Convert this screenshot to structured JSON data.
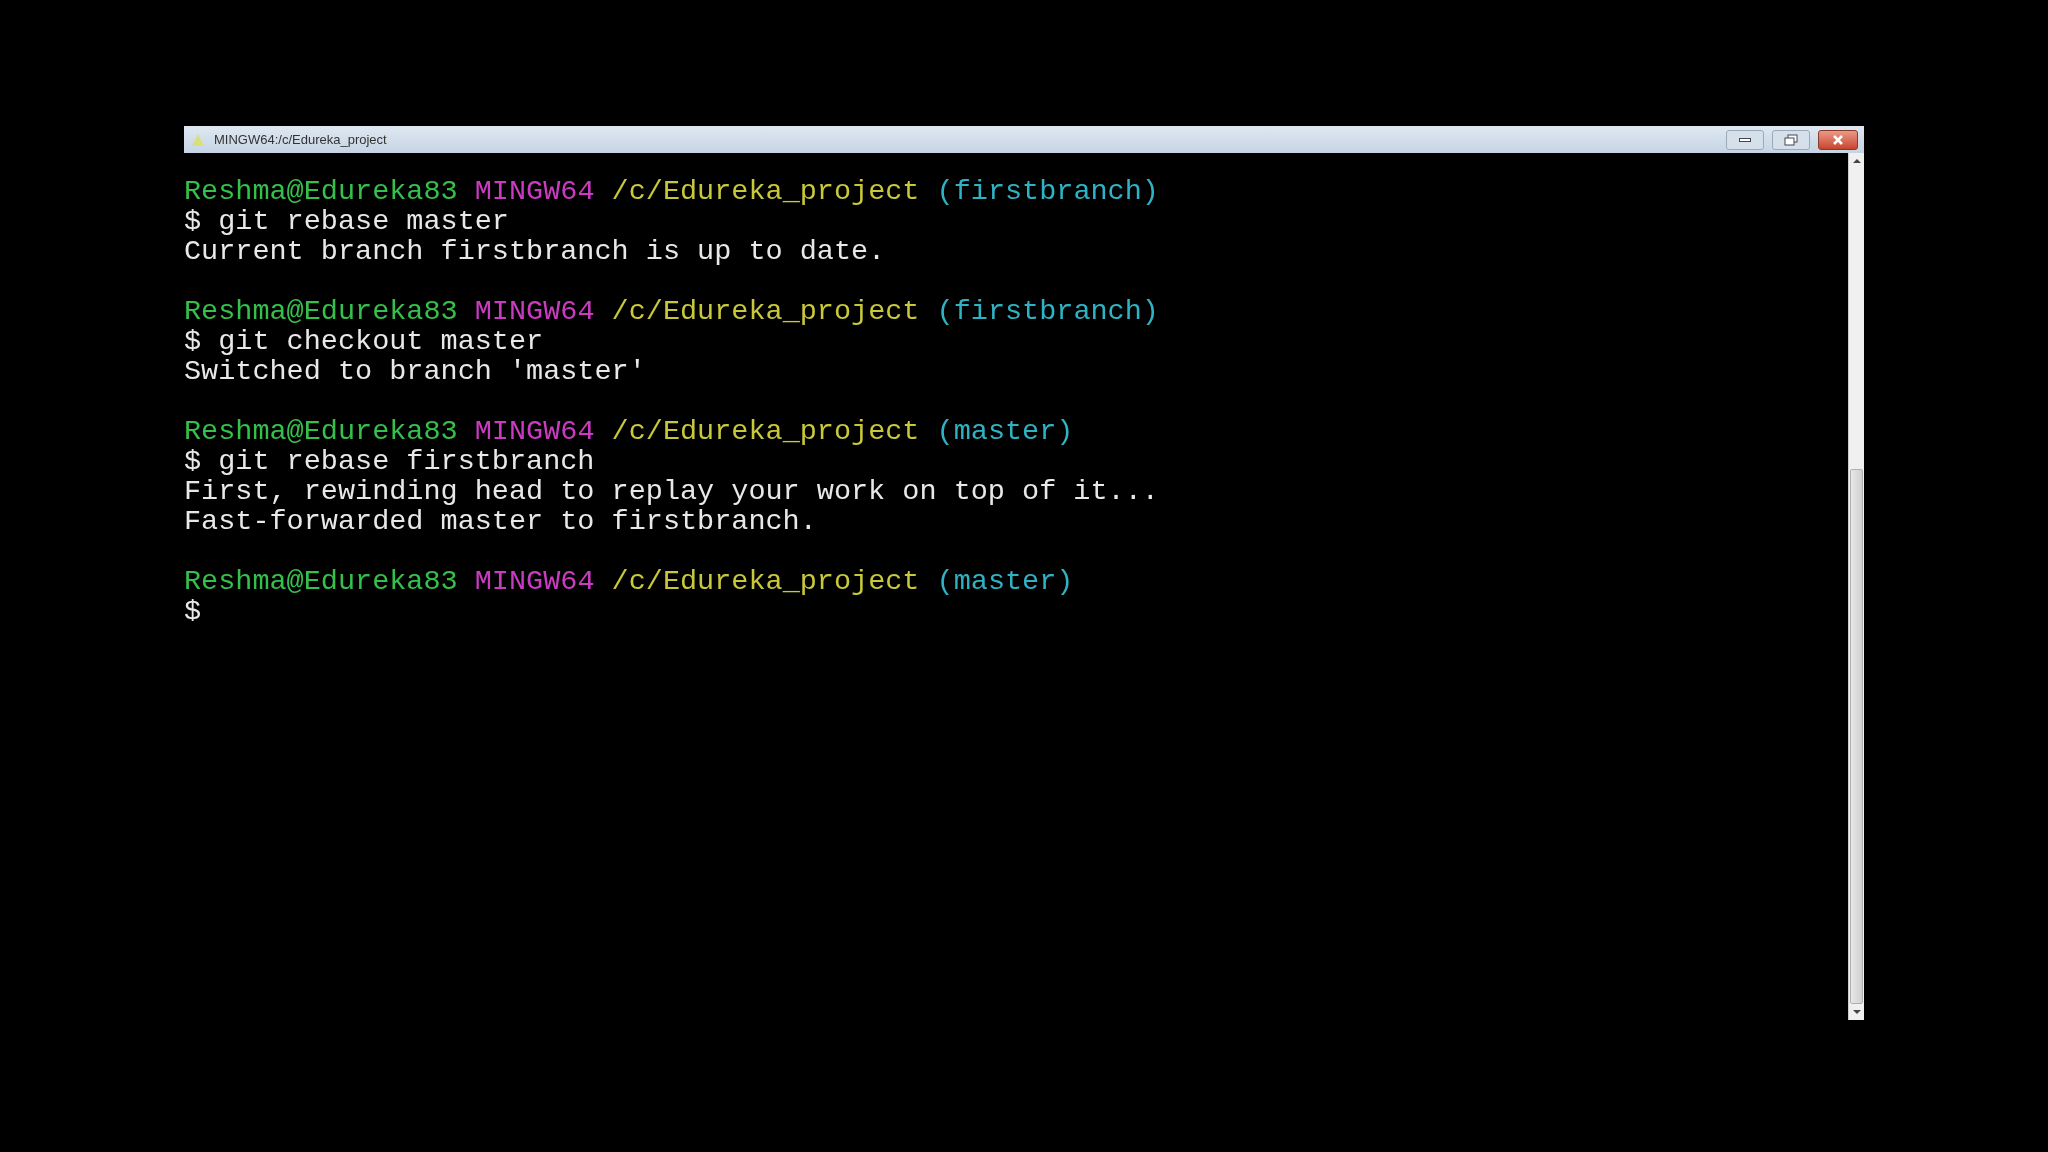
{
  "window": {
    "title": "MINGW64:/c/Edureka_project"
  },
  "blocks": [
    {
      "prompt": {
        "user_host": "Reshma@Edureka83",
        "system": "MINGW64",
        "path": "/c/Edureka_project",
        "branch": "(firstbranch)"
      },
      "command": "$ git rebase master",
      "output": [
        "Current branch firstbranch is up to date."
      ]
    },
    {
      "prompt": {
        "user_host": "Reshma@Edureka83",
        "system": "MINGW64",
        "path": "/c/Edureka_project",
        "branch": "(firstbranch)"
      },
      "command": "$ git checkout master",
      "output": [
        "Switched to branch 'master'"
      ]
    },
    {
      "prompt": {
        "user_host": "Reshma@Edureka83",
        "system": "MINGW64",
        "path": "/c/Edureka_project",
        "branch": "(master)"
      },
      "command": "$ git rebase firstbranch",
      "output": [
        "First, rewinding head to replay your work on top of it...",
        "Fast-forwarded master to firstbranch."
      ]
    },
    {
      "prompt": {
        "user_host": "Reshma@Edureka83",
        "system": "MINGW64",
        "path": "/c/Edureka_project",
        "branch": "(master)"
      },
      "command": "$"
    }
  ]
}
